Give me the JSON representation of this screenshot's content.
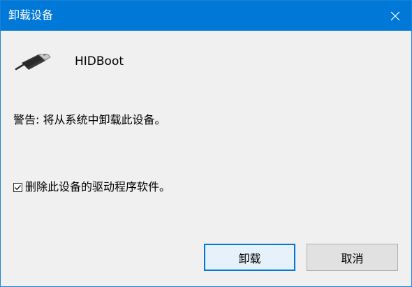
{
  "window": {
    "title": "卸载设备",
    "close_icon": "close-icon",
    "accent_color": "#0078d7"
  },
  "device": {
    "icon": "usb-plug-icon",
    "name": "HIDBoot"
  },
  "warning_text": "警告: 将从系统中卸载此设备。",
  "delete_driver": {
    "checked": true,
    "label": "删除此设备的驱动程序软件。"
  },
  "buttons": {
    "uninstall_label": "卸载",
    "cancel_label": "取消"
  }
}
